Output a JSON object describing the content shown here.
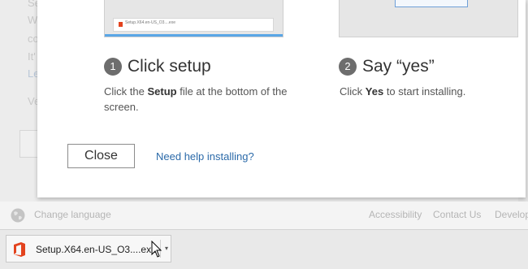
{
  "backdrop": {
    "fragments": [
      "Se",
      "W",
      "co",
      "It'",
      "Le",
      "Ve"
    ]
  },
  "modal": {
    "thumbnail1": {
      "file_text": "Setup.X64.en-US_O3....exe"
    },
    "steps": [
      {
        "number": "1",
        "title": "Click setup",
        "desc_before": "Click the ",
        "desc_bold": "Setup",
        "desc_after": " file at the bottom of the screen."
      },
      {
        "number": "2",
        "title": "Say “yes”",
        "desc_before": "Click ",
        "desc_bold": "Yes",
        "desc_after": " to start installing."
      }
    ],
    "close_label": "Close",
    "help_label": "Need help installing?"
  },
  "footer": {
    "language_label": "Change language",
    "links": [
      "Accessibility",
      "Contact Us",
      "Develop"
    ]
  },
  "download_bar": {
    "file_name": "Setup.X64.en-US_O3....exe",
    "dropdown_glyph": "▾"
  },
  "colors": {
    "link": "#2b6aa9",
    "office_icon": "#e3431e",
    "step_badge": "#6d6d6d"
  }
}
